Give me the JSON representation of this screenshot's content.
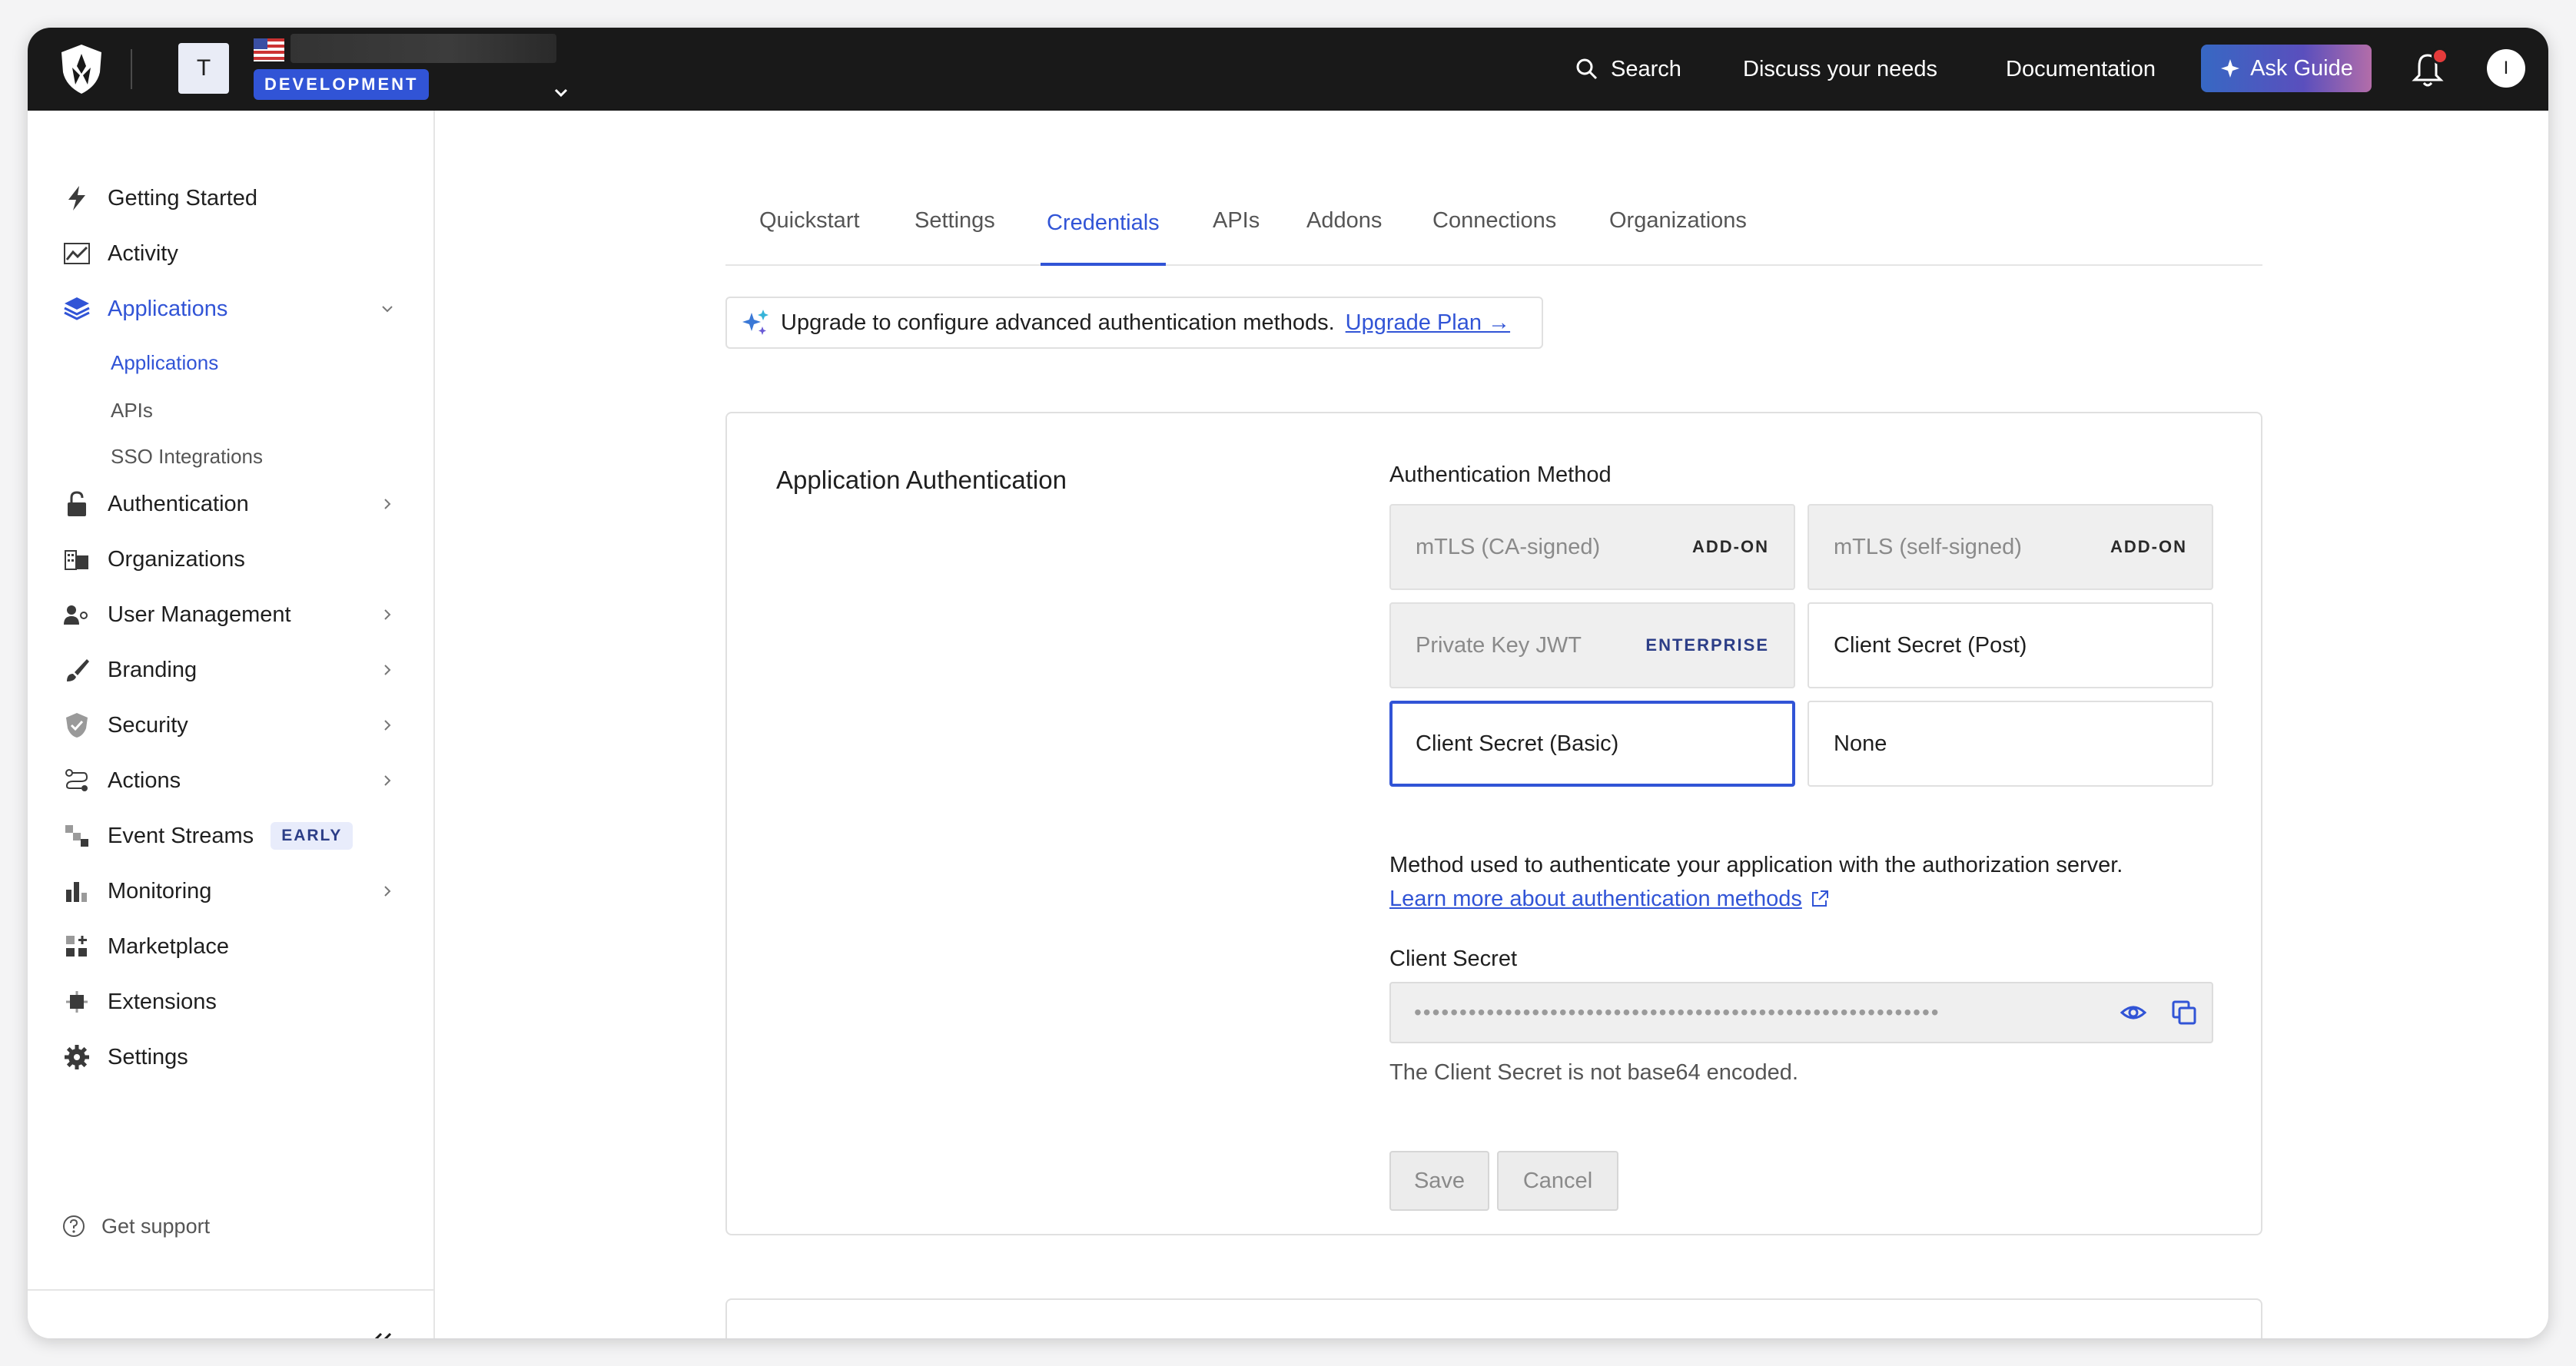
{
  "header": {
    "tenant_initial": "T",
    "environment_badge": "DEVELOPMENT",
    "search_label": "Search",
    "discuss_label": "Discuss your needs",
    "documentation_label": "Documentation",
    "ask_guide_label": "Ask Guide",
    "user_initial": "I"
  },
  "sidebar": {
    "items": [
      {
        "label": "Getting Started",
        "icon": "bolt-icon"
      },
      {
        "label": "Activity",
        "icon": "chart-line-icon"
      },
      {
        "label": "Applications",
        "icon": "layers-icon"
      },
      {
        "label": "Authentication",
        "icon": "lock-icon"
      },
      {
        "label": "Organizations",
        "icon": "building-icon"
      },
      {
        "label": "User Management",
        "icon": "users-icon"
      },
      {
        "label": "Branding",
        "icon": "brush-icon"
      },
      {
        "label": "Security",
        "icon": "shield-icon"
      },
      {
        "label": "Actions",
        "icon": "flow-icon"
      },
      {
        "label": "Event Streams",
        "icon": "stream-icon",
        "badge": "EARLY"
      },
      {
        "label": "Monitoring",
        "icon": "bar-chart-icon"
      },
      {
        "label": "Marketplace",
        "icon": "grid-plus-icon"
      },
      {
        "label": "Extensions",
        "icon": "puzzle-icon"
      },
      {
        "label": "Settings",
        "icon": "gear-icon"
      }
    ],
    "sub_items": [
      "Applications",
      "APIs",
      "SSO Integrations"
    ],
    "get_support": "Get support"
  },
  "tabs": [
    "Quickstart",
    "Settings",
    "Credentials",
    "APIs",
    "Addons",
    "Connections",
    "Organizations"
  ],
  "upgrade_banner": {
    "text": "Upgrade to configure advanced authentication methods.",
    "link": "Upgrade Plan →"
  },
  "auth_section": {
    "title": "Application Authentication",
    "method_label": "Authentication Method",
    "methods": [
      {
        "label": "mTLS (CA-signed)",
        "tag": "ADD-ON"
      },
      {
        "label": "mTLS (self-signed)",
        "tag": "ADD-ON"
      },
      {
        "label": "Private Key JWT",
        "tag": "ENTERPRISE"
      },
      {
        "label": "Client Secret (Post)",
        "tag": ""
      },
      {
        "label": "Client Secret (Basic)",
        "tag": ""
      },
      {
        "label": "None",
        "tag": ""
      }
    ],
    "help_text": "Method used to authenticate your application with the authorization server.",
    "help_link": "Learn more about authentication methods",
    "secret_label": "Client Secret",
    "secret_masked": "••••••••••••••••••••••••••••••••••••••••••••••••••••••••••",
    "secret_note": "The Client Secret is not base64 encoded.",
    "save_label": "Save",
    "cancel_label": "Cancel"
  },
  "colors": {
    "accent": "#3154d6",
    "topbar": "#191919"
  }
}
